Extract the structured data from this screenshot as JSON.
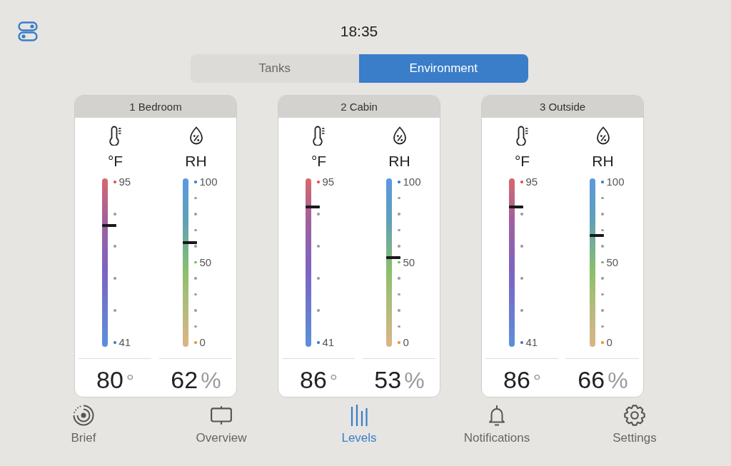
{
  "top_bar": {
    "time": "18:35"
  },
  "tabs": [
    {
      "label": "Tanks",
      "selected": false
    },
    {
      "label": "Environment",
      "selected": true
    }
  ],
  "zones": [
    {
      "title": "1 Bedroom",
      "gauges": [
        {
          "kind": "temperature",
          "unit": "°F",
          "level": 0.72,
          "ticks": [
            {
              "label": "95",
              "color": "#e8504f"
            },
            {
              "color": "#9e9e9e"
            },
            {
              "color": "#9e9e9e"
            },
            {
              "color": "#9e9e9e"
            },
            {
              "color": "#9e9e9e"
            },
            {
              "label": "41",
              "color": "#3a7dc9"
            }
          ],
          "reading": "80",
          "reading_unit": "°"
        },
        {
          "kind": "humidity",
          "unit": "RH",
          "level": 0.62,
          "ticks": [
            {
              "label": "100",
              "color": "#3a7dc9"
            },
            {
              "color": "#9e9e9e"
            },
            {
              "color": "#9e9e9e"
            },
            {
              "color": "#9e9e9e"
            },
            {
              "color": "#9e9e9e"
            },
            {
              "label": "50",
              "color": "#6bbf4e"
            },
            {
              "color": "#9e9e9e"
            },
            {
              "color": "#9e9e9e"
            },
            {
              "color": "#9e9e9e"
            },
            {
              "color": "#9e9e9e"
            },
            {
              "label": "0",
              "color": "#f0922b"
            }
          ],
          "reading": "62",
          "reading_unit": "%"
        }
      ]
    },
    {
      "title": "2 Cabin",
      "gauges": [
        {
          "kind": "temperature",
          "unit": "°F",
          "level": 0.83,
          "ticks": [
            {
              "label": "95",
              "color": "#e8504f"
            },
            {
              "color": "#9e9e9e"
            },
            {
              "color": "#9e9e9e"
            },
            {
              "color": "#9e9e9e"
            },
            {
              "color": "#9e9e9e"
            },
            {
              "label": "41",
              "color": "#3a7dc9"
            }
          ],
          "reading": "86",
          "reading_unit": "°"
        },
        {
          "kind": "humidity",
          "unit": "RH",
          "level": 0.53,
          "ticks": [
            {
              "label": "100",
              "color": "#3a7dc9"
            },
            {
              "color": "#9e9e9e"
            },
            {
              "color": "#9e9e9e"
            },
            {
              "color": "#9e9e9e"
            },
            {
              "color": "#9e9e9e"
            },
            {
              "label": "50",
              "color": "#6bbf4e"
            },
            {
              "color": "#9e9e9e"
            },
            {
              "color": "#9e9e9e"
            },
            {
              "color": "#9e9e9e"
            },
            {
              "color": "#9e9e9e"
            },
            {
              "label": "0",
              "color": "#f0922b"
            }
          ],
          "reading": "53",
          "reading_unit": "%"
        }
      ]
    },
    {
      "title": "3 Outside",
      "gauges": [
        {
          "kind": "temperature",
          "unit": "°F",
          "level": 0.83,
          "ticks": [
            {
              "label": "95",
              "color": "#e8504f"
            },
            {
              "color": "#9e9e9e"
            },
            {
              "color": "#9e9e9e"
            },
            {
              "color": "#9e9e9e"
            },
            {
              "color": "#9e9e9e"
            },
            {
              "label": "41",
              "color": "#3a7dc9"
            }
          ],
          "reading": "86",
          "reading_unit": "°"
        },
        {
          "kind": "humidity",
          "unit": "RH",
          "level": 0.66,
          "ticks": [
            {
              "label": "100",
              "color": "#3a7dc9"
            },
            {
              "color": "#9e9e9e"
            },
            {
              "color": "#9e9e9e"
            },
            {
              "color": "#9e9e9e"
            },
            {
              "color": "#9e9e9e"
            },
            {
              "label": "50",
              "color": "#6bbf4e"
            },
            {
              "color": "#9e9e9e"
            },
            {
              "color": "#9e9e9e"
            },
            {
              "color": "#9e9e9e"
            },
            {
              "color": "#9e9e9e"
            },
            {
              "label": "0",
              "color": "#f0922b"
            }
          ],
          "reading": "66",
          "reading_unit": "%"
        }
      ]
    }
  ],
  "nav": [
    {
      "label": "Brief",
      "selected": false
    },
    {
      "label": "Overview",
      "selected": false
    },
    {
      "label": "Levels",
      "selected": true
    },
    {
      "label": "Notifications",
      "selected": false
    },
    {
      "label": "Settings",
      "selected": false
    }
  ]
}
